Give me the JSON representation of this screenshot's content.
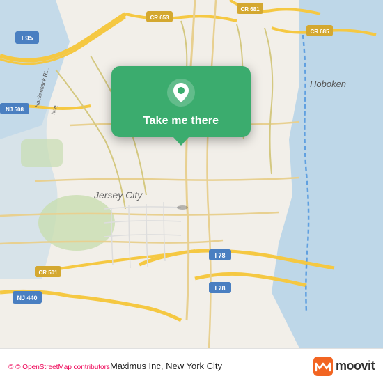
{
  "map": {
    "attribution": "© OpenStreetMap contributors",
    "attribution_symbol": "©"
  },
  "popup": {
    "label": "Take me there",
    "icon": "location-pin-icon"
  },
  "bottom_bar": {
    "location_name": "Maximus Inc, New York City",
    "brand": "moovit"
  }
}
